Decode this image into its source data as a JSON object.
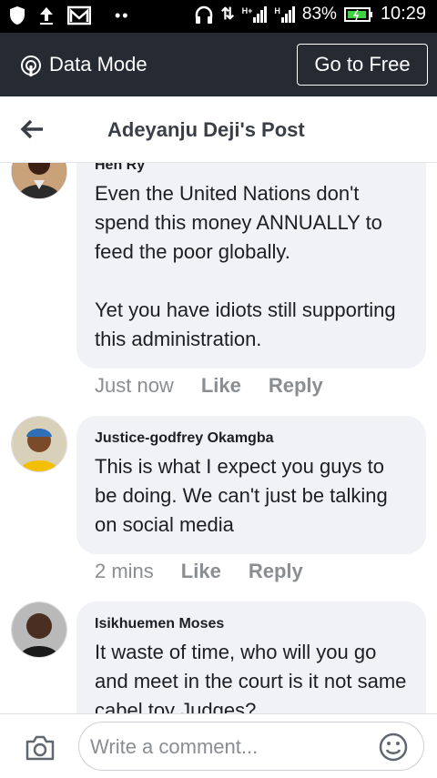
{
  "status": {
    "battery": "83%",
    "time": "10:29",
    "signal1": "H+",
    "signal2": "H"
  },
  "databar": {
    "label": "Data Mode",
    "goto_label": "Go to Free"
  },
  "header": {
    "title": "Adeyanju Deji's Post"
  },
  "comments": [
    {
      "name": "Hen Ry",
      "text": "Even the United Nations don't spend this money ANNUALLY to feed the poor globally.\n\nYet you have idiots still supporting this administration.",
      "time": "Just now",
      "like": "Like",
      "reply": "Reply"
    },
    {
      "name": "Justice-godfrey Okamgba",
      "text": "This is what I expect you guys to be doing. We can't just be talking on social media",
      "time": "2 mins",
      "like": "Like",
      "reply": "Reply"
    },
    {
      "name": "Isikhuemen Moses",
      "text": "It waste of time, who will you go and meet in the court is it not same cabel toy Judges?",
      "time": "",
      "like": "",
      "reply": ""
    }
  ],
  "composer": {
    "placeholder": "Write a comment..."
  }
}
